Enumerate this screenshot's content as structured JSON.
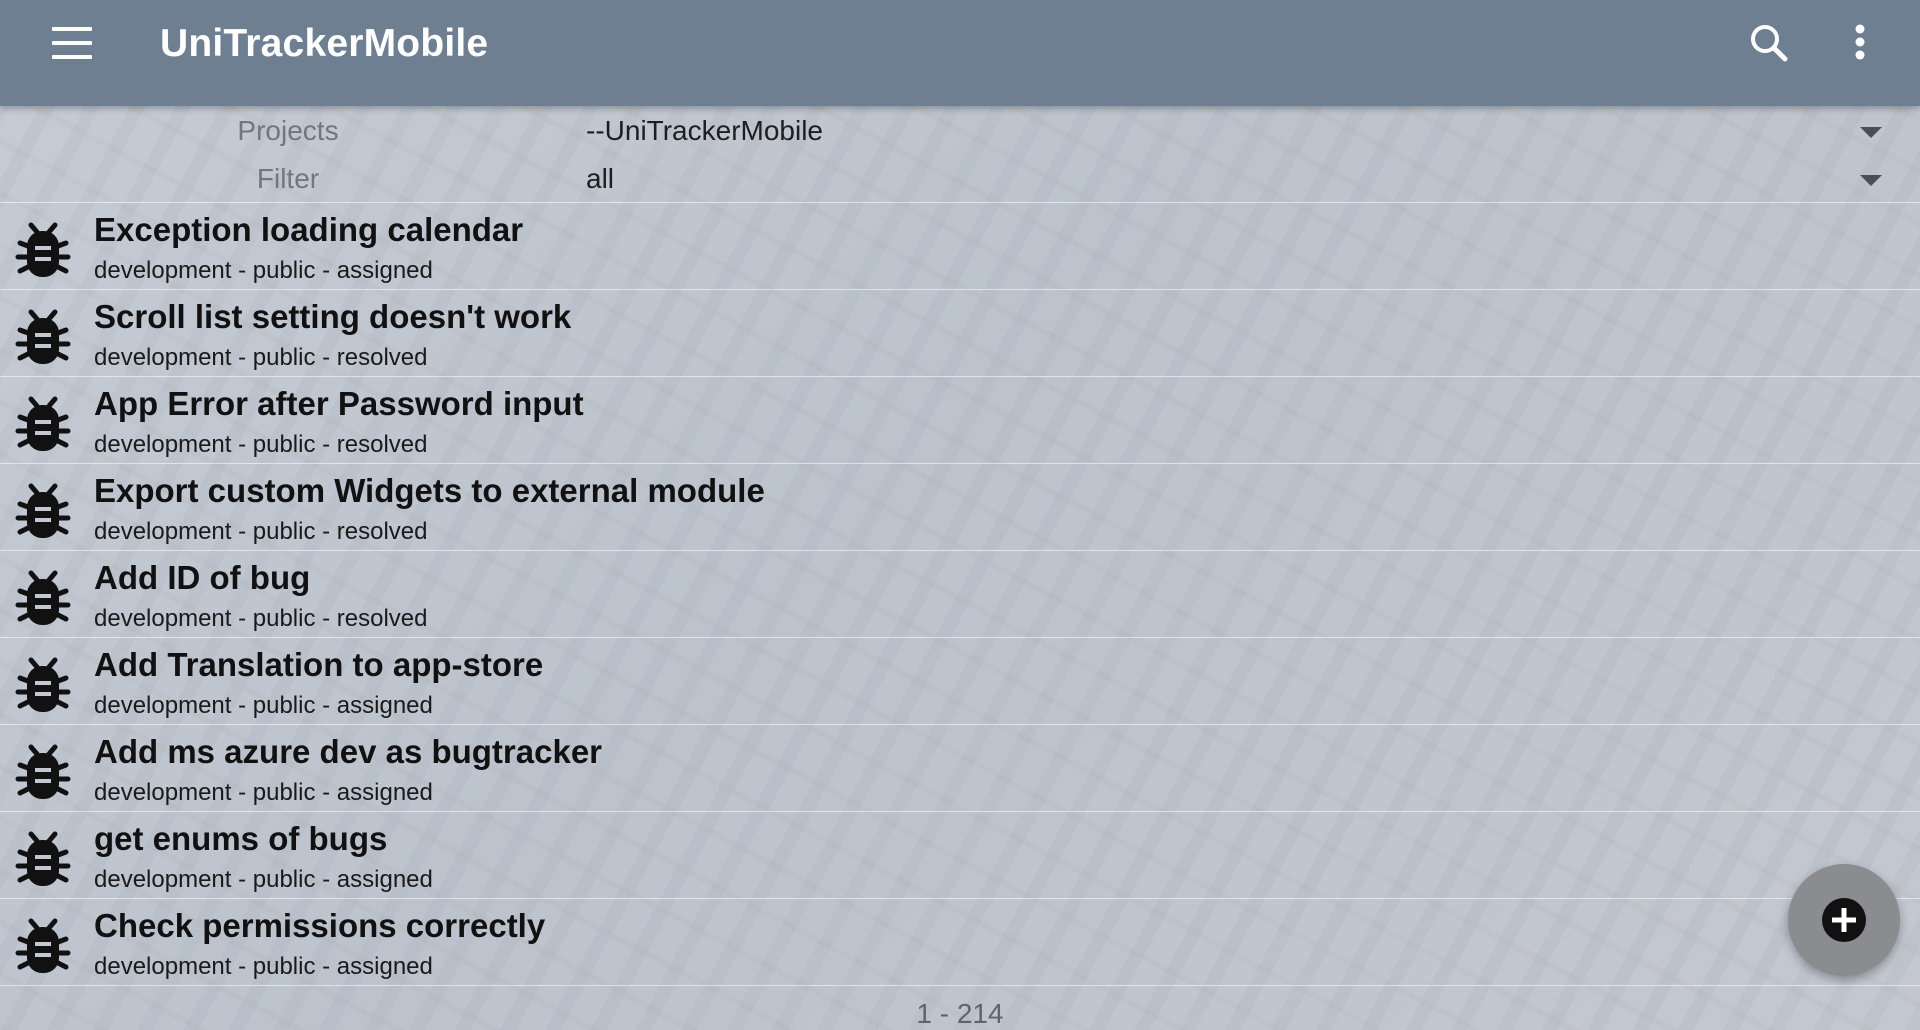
{
  "app": {
    "title": "UniTrackerMobile"
  },
  "toolbar": {
    "menu_icon": "hamburger-menu-icon",
    "search_icon": "search-icon",
    "more_icon": "more-vert-icon"
  },
  "selectors": {
    "projects": {
      "label": "Projects",
      "value": "--UniTrackerMobile"
    },
    "filter": {
      "label": "Filter",
      "value": "all"
    }
  },
  "bugs": [
    {
      "title": "Exception loading calendar",
      "meta": "development - public - assigned"
    },
    {
      "title": "Scroll list setting doesn't work",
      "meta": "development - public - resolved"
    },
    {
      "title": "App Error after Password input",
      "meta": "development - public - resolved"
    },
    {
      "title": "Export custom Widgets to external module",
      "meta": "development - public - resolved"
    },
    {
      "title": "Add ID of bug",
      "meta": "development - public - resolved"
    },
    {
      "title": "Add Translation to app-store",
      "meta": "development - public - assigned"
    },
    {
      "title": "Add ms azure dev as bugtracker",
      "meta": "development - public - assigned"
    },
    {
      "title": "get enums of bugs",
      "meta": "development - public - assigned"
    },
    {
      "title": "Check permissions correctly",
      "meta": "development - public - assigned"
    }
  ],
  "pagination": {
    "text": "1 - 214"
  },
  "fab": {
    "icon": "add-icon"
  },
  "colors": {
    "appbar": "#6f7f92",
    "fab": "#8a8c90",
    "text": "#111111"
  }
}
